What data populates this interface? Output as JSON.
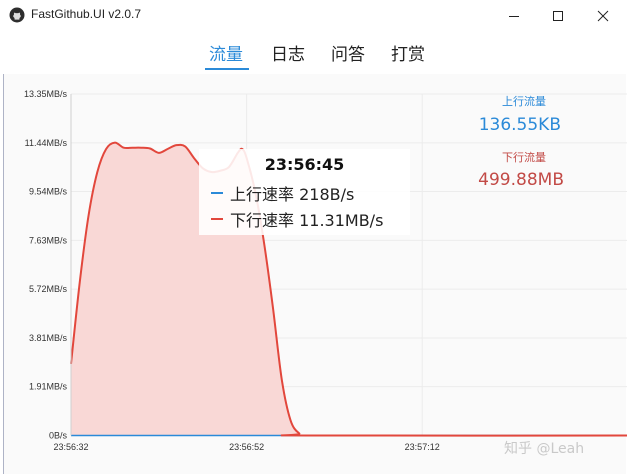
{
  "window": {
    "title": "FastGithub.UI v2.0.7"
  },
  "tabs": [
    {
      "label": "流量",
      "active": true
    },
    {
      "label": "日志",
      "active": false
    },
    {
      "label": "问答",
      "active": false
    },
    {
      "label": "打赏",
      "active": false
    }
  ],
  "stats": {
    "upload_label": "上行流量",
    "upload_value": "136.55KB",
    "upload_color": "#2b8ad8",
    "download_label": "下行流量",
    "download_value": "499.88MB",
    "download_color": "#c24a46"
  },
  "tooltip": {
    "time": "23:56:45",
    "upload_text": "上行速率 218B/s",
    "download_text": "下行速率 11.31MB/s"
  },
  "watermark": "知乎 @Leah",
  "chart_data": {
    "type": "area",
    "y_tick_labels": [
      "0B/s",
      "1.91MB/s",
      "3.81MB/s",
      "5.72MB/s",
      "7.63MB/s",
      "9.54MB/s",
      "11.44MB/s",
      "13.35MB/s"
    ],
    "y_ticks": [
      0,
      1.91,
      3.81,
      5.72,
      7.63,
      9.54,
      11.44,
      13.35
    ],
    "ylim": [
      0,
      13.35
    ],
    "yunit": "MB/s",
    "x_tick_labels": [
      "23:56:32",
      "23:56:52",
      "23:57:12"
    ],
    "x_ticks_sec": [
      0,
      20,
      40
    ],
    "xlim_sec": [
      0,
      64
    ],
    "grid": true,
    "series": [
      {
        "name": "上行速率",
        "color": "#2b8ad8",
        "points": [
          [
            0,
            0.0002
          ],
          [
            10,
            0.0002
          ],
          [
            20,
            0.0002
          ],
          [
            30,
            0.0002
          ],
          [
            40,
            0.0002
          ],
          [
            50,
            0.0002
          ],
          [
            64,
            0.0002
          ]
        ]
      },
      {
        "name": "下行速率",
        "color": "#e2473c",
        "fill": "#f9d8d6",
        "points": [
          [
            0,
            2.8
          ],
          [
            1,
            6.0
          ],
          [
            2,
            8.6
          ],
          [
            3,
            10.3
          ],
          [
            4,
            11.2
          ],
          [
            5,
            11.45
          ],
          [
            6,
            11.25
          ],
          [
            7,
            11.25
          ],
          [
            8,
            11.25
          ],
          [
            9,
            11.22
          ],
          [
            10,
            11.05
          ],
          [
            11,
            11.2
          ],
          [
            12,
            11.35
          ],
          [
            13,
            11.3
          ],
          [
            14,
            10.85
          ],
          [
            15,
            10.45
          ],
          [
            16,
            10.3
          ],
          [
            17,
            10.35
          ],
          [
            18,
            10.5
          ],
          [
            19,
            11.05
          ],
          [
            19.5,
            11.2
          ],
          [
            20,
            10.85
          ],
          [
            21,
            9.5
          ],
          [
            22,
            7.5
          ],
          [
            23,
            5.0
          ],
          [
            24,
            2.2
          ],
          [
            25,
            0.6
          ],
          [
            26,
            0.08
          ],
          [
            27,
            0.0
          ],
          [
            64,
            0.0
          ]
        ]
      }
    ]
  }
}
